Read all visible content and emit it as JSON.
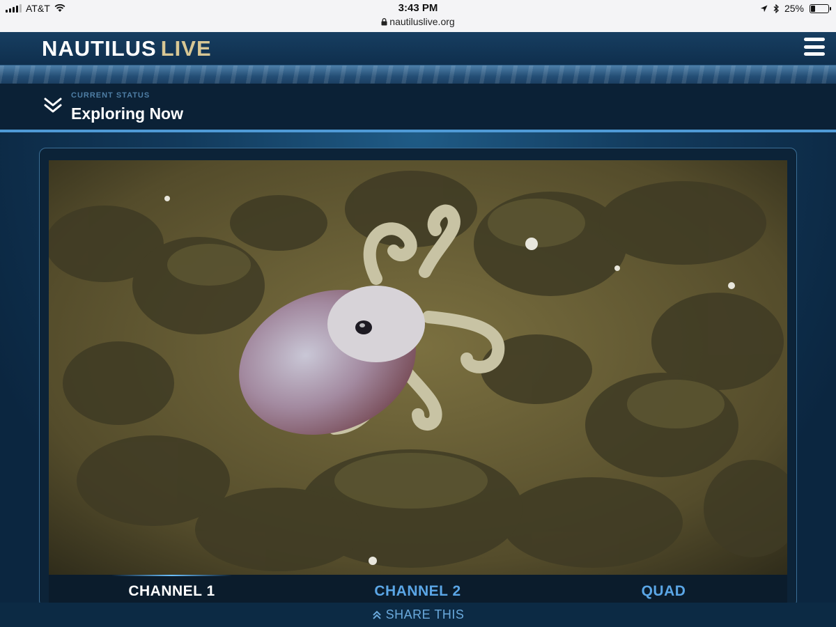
{
  "status_bar": {
    "carrier": "AT&T",
    "time": "3:43 PM",
    "url": "nautiluslive.org",
    "battery": "25%",
    "battery_level": 0.25
  },
  "header": {
    "logo_main": "NAUTILUS",
    "logo_accent": "LIVE"
  },
  "status": {
    "label": "CURRENT STATUS",
    "value": "Exploring Now"
  },
  "channels": [
    {
      "label": "CHANNEL 1",
      "active": true
    },
    {
      "label": "CHANNEL 2",
      "active": false
    },
    {
      "label": "QUAD",
      "active": false
    }
  ],
  "share": {
    "label": "SHARE THIS"
  },
  "colors": {
    "accent": "#5ba6e6",
    "logo_accent": "#d8c794",
    "header_bg": "#173e61"
  }
}
